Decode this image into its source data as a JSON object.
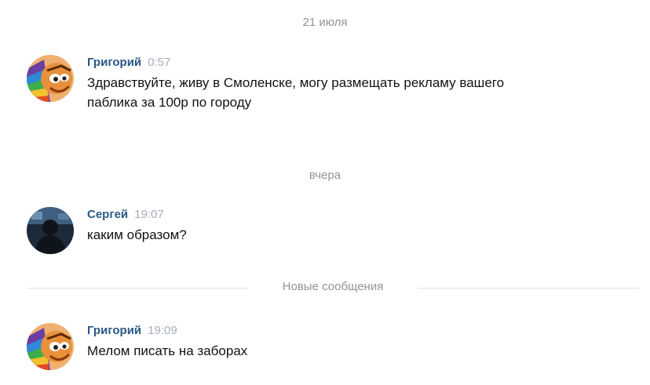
{
  "date_separators": [
    "21 июля",
    "вчера"
  ],
  "new_messages_divider": "Новые сообщения",
  "messages": [
    {
      "author": "Григорий",
      "time": "0:57",
      "text": "Здравствуйте, живу в Смоленске, могу размещать рекламу вашего паблика за 100р по городу",
      "avatar_icon": "cartoon-face-avatar"
    },
    {
      "author": "Сергей",
      "time": "19:07",
      "text": "каким образом?",
      "avatar_icon": "dark-photo-avatar"
    },
    {
      "author": "Григорий",
      "time": "19:09",
      "text": "Мелом писать на заборах",
      "avatar_icon": "cartoon-face-avatar"
    }
  ],
  "colors": {
    "author_link": "#2a5885",
    "timestamp": "#a5adb8",
    "separator_text": "#939393",
    "divider_line": "#dfe2e6"
  }
}
